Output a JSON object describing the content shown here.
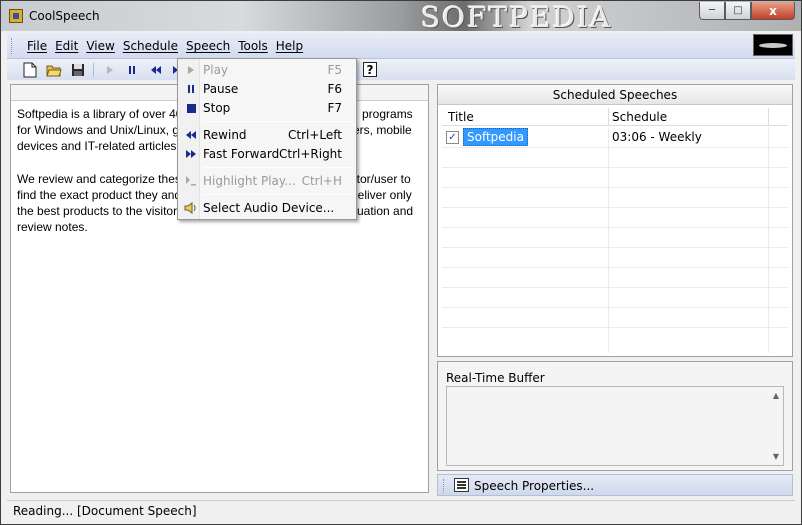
{
  "window": {
    "title": "CoolSpeech",
    "watermark": "SOFTPEDIA",
    "buttons": {
      "minimize": "─",
      "maximize": "□",
      "close": "x"
    }
  },
  "menubar": {
    "items": [
      "File",
      "Edit",
      "View",
      "Schedule",
      "Speech",
      "Tools",
      "Help"
    ]
  },
  "toolbar": {
    "icons": [
      "new-document-icon",
      "open-folder-icon",
      "save-icon",
      "play-icon",
      "pause-icon",
      "rewind-icon",
      "fast-forward-icon",
      "help-icon"
    ],
    "help_label": "?"
  },
  "speech_menu": {
    "items": [
      {
        "label": "Play",
        "shortcut": "F5",
        "disabled": true,
        "icon": "play-icon"
      },
      {
        "label": "Pause",
        "shortcut": "F6",
        "disabled": false,
        "icon": "pause-icon"
      },
      {
        "label": "Stop",
        "shortcut": "F7",
        "disabled": false,
        "icon": "stop-icon"
      },
      {
        "label": "Rewind",
        "shortcut": "Ctrl+Left",
        "disabled": false,
        "icon": "rewind-icon"
      },
      {
        "label": "Fast Forward",
        "shortcut": "Ctrl+Right",
        "disabled": false,
        "icon": "fast-forward-icon"
      },
      {
        "label": "Highlight Play...",
        "shortcut": "Ctrl+H",
        "disabled": true,
        "icon": "highlight-play-icon"
      },
      {
        "label": "Select Audio Device...",
        "shortcut": "",
        "disabled": false,
        "icon": "speaker-icon"
      }
    ]
  },
  "document": {
    "paragraph1": "Softpedia is a library of over 40 programs for Windows and Unix/Linux, g vers, mobile devices and IT-related articles.",
    "paragraph2": "We review and categorize these itor/user to find the exact product they and deliver only the best products to the visitor uation and review notes.",
    "lines": [
      [
        "Softpedia is a library of over 40",
        "programs"
      ],
      [
        "for Windows and Unix/Linux, g",
        "vers, mobile"
      ],
      [
        "devices and IT-related articles.",
        ""
      ],
      [
        "We review and categorize these",
        "itor/user to"
      ],
      [
        "find the exact product they and",
        "deliver only"
      ],
      [
        "the best products to the visitor",
        "uation and"
      ],
      [
        "review notes.",
        ""
      ]
    ]
  },
  "scheduled": {
    "header": "Scheduled Speeches",
    "columns": [
      "Title",
      "Schedule"
    ],
    "rows": [
      {
        "checked": true,
        "title": "Softpedia",
        "schedule": "03:06 - Weekly"
      }
    ]
  },
  "buffer": {
    "label": "Real-Time Buffer"
  },
  "properties": {
    "label": "Speech Properties..."
  },
  "status": {
    "text": "Reading... [Document Speech]"
  },
  "colors": {
    "selection": "#3399ff",
    "toolbar_icon": "#1a2a8a"
  }
}
